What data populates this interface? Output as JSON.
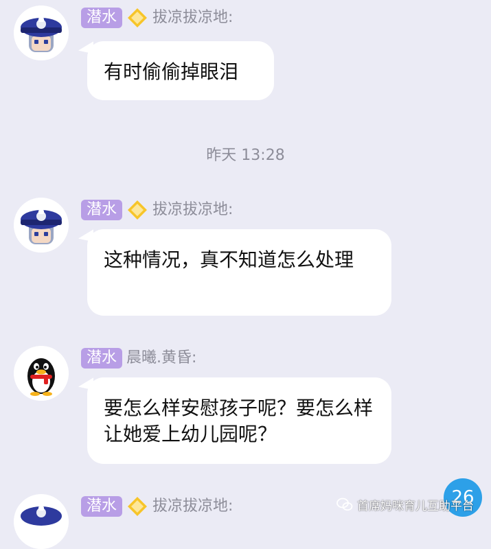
{
  "colors": {
    "background": "#ebebf5",
    "bubble": "#ffffff",
    "badge": "#b89ee6",
    "sender": "#8d8d99",
    "unread": "#2da0e8"
  },
  "messages": [
    {
      "avatar": "sailor-hat-avatar",
      "badge": "潜水",
      "sender": "拔凉拔凉地:",
      "text": "有时偷偷掉眼泪"
    },
    {
      "avatar": "sailor-hat-avatar",
      "badge": "潜水",
      "sender": "拔凉拔凉地:",
      "text": "这种情况，真不知道怎么处理"
    },
    {
      "avatar": "qq-penguin-avatar",
      "badge": "潜水",
      "sender": "晨曦.黄昏:",
      "text": "要怎么样安慰孩子呢？要怎么样让她爱上幼儿园呢？"
    },
    {
      "avatar": "sailor-hat-avatar",
      "badge": "潜水",
      "sender": "拔凉拔凉地:"
    }
  ],
  "timestamp": "昨天 13:28",
  "unread_count": "26",
  "watermark": "首席妈咪育儿互助平台"
}
